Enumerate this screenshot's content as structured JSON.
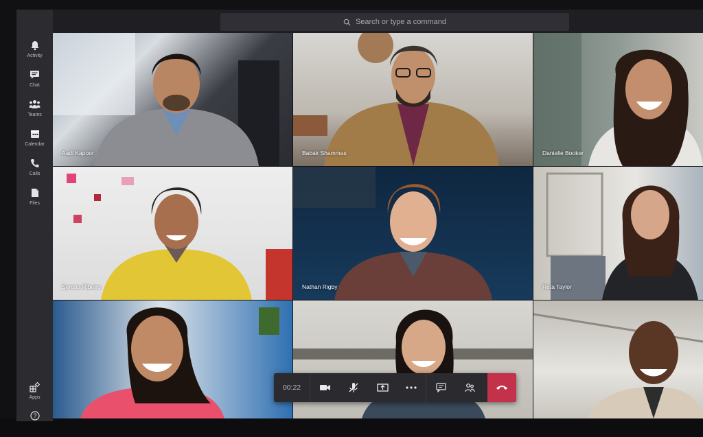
{
  "search": {
    "placeholder": "Search or type a command"
  },
  "sidebar": {
    "items": [
      {
        "label": "Activity",
        "icon": "bell-icon"
      },
      {
        "label": "Chat",
        "icon": "chat-icon"
      },
      {
        "label": "Teams",
        "icon": "teams-icon"
      },
      {
        "label": "Calendar",
        "icon": "calendar-icon"
      },
      {
        "label": "Calls",
        "icon": "phone-icon"
      },
      {
        "label": "Files",
        "icon": "file-icon"
      }
    ],
    "bottom": [
      {
        "label": "Apps",
        "icon": "apps-icon"
      },
      {
        "label": "",
        "icon": "help-icon"
      }
    ]
  },
  "participants": [
    {
      "name": "Aadi Kapoor"
    },
    {
      "name": "Babak Shammas"
    },
    {
      "name": "Danielle Booker"
    },
    {
      "name": "Serena Ribeiro"
    },
    {
      "name": "Nathan Rigby"
    },
    {
      "name": "Reta Taylor"
    },
    {
      "name": "",
      "note": "partially hidden"
    },
    {
      "name": "",
      "note": "partially hidden"
    },
    {
      "name": "",
      "note": "partially hidden"
    }
  ],
  "callbar": {
    "timer": "00:22",
    "buttons": [
      "video-camera-icon",
      "mic-off-icon",
      "share-screen-icon",
      "more-icon",
      "chat-icon",
      "participants-icon"
    ],
    "hangup": "hangup-icon"
  },
  "colors": {
    "accent": "#c4314b",
    "sidebar": "#2b2b30",
    "topbar": "#1f1f23"
  }
}
